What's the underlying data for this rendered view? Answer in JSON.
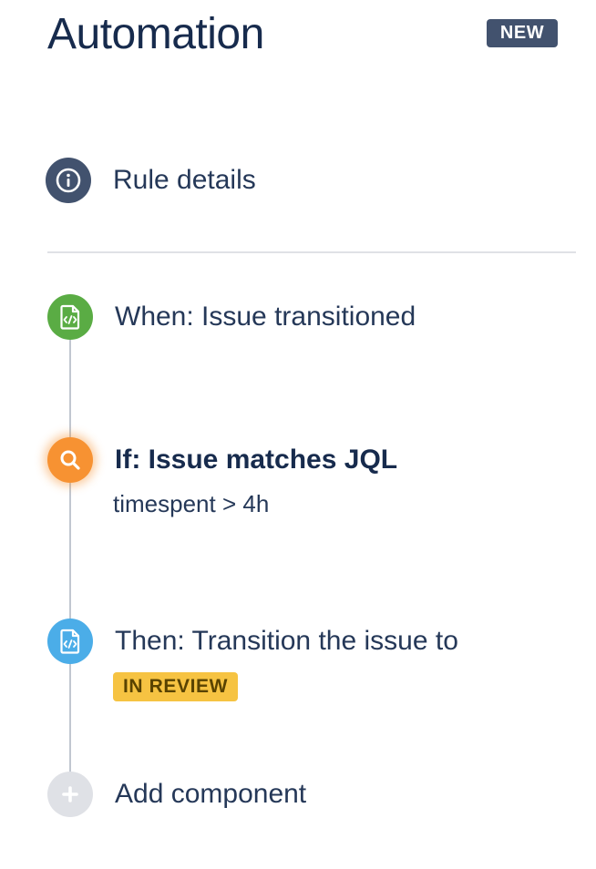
{
  "header": {
    "title": "Automation",
    "badge": "NEW"
  },
  "rule_details": {
    "label": "Rule details",
    "icon": "info-icon",
    "color": "#42526e"
  },
  "steps": [
    {
      "label": "When: Issue transitioned",
      "icon": "trigger-document-icon",
      "color": "#5aac44"
    },
    {
      "label": "If: Issue matches JQL",
      "detail": "timespent > 4h",
      "icon": "search-icon",
      "color": "#f79232"
    },
    {
      "label": "Then: Transition the issue to",
      "status": "IN REVIEW",
      "icon": "action-document-icon",
      "color": "#4bade8",
      "status_color": "#f6c342"
    },
    {
      "label": "Add component",
      "icon": "plus-icon",
      "color": "#dfe1e6"
    }
  ],
  "colors": {
    "title": "#172b4d",
    "divider": "#dfe1e6",
    "timeline": "#c1c7d0"
  }
}
